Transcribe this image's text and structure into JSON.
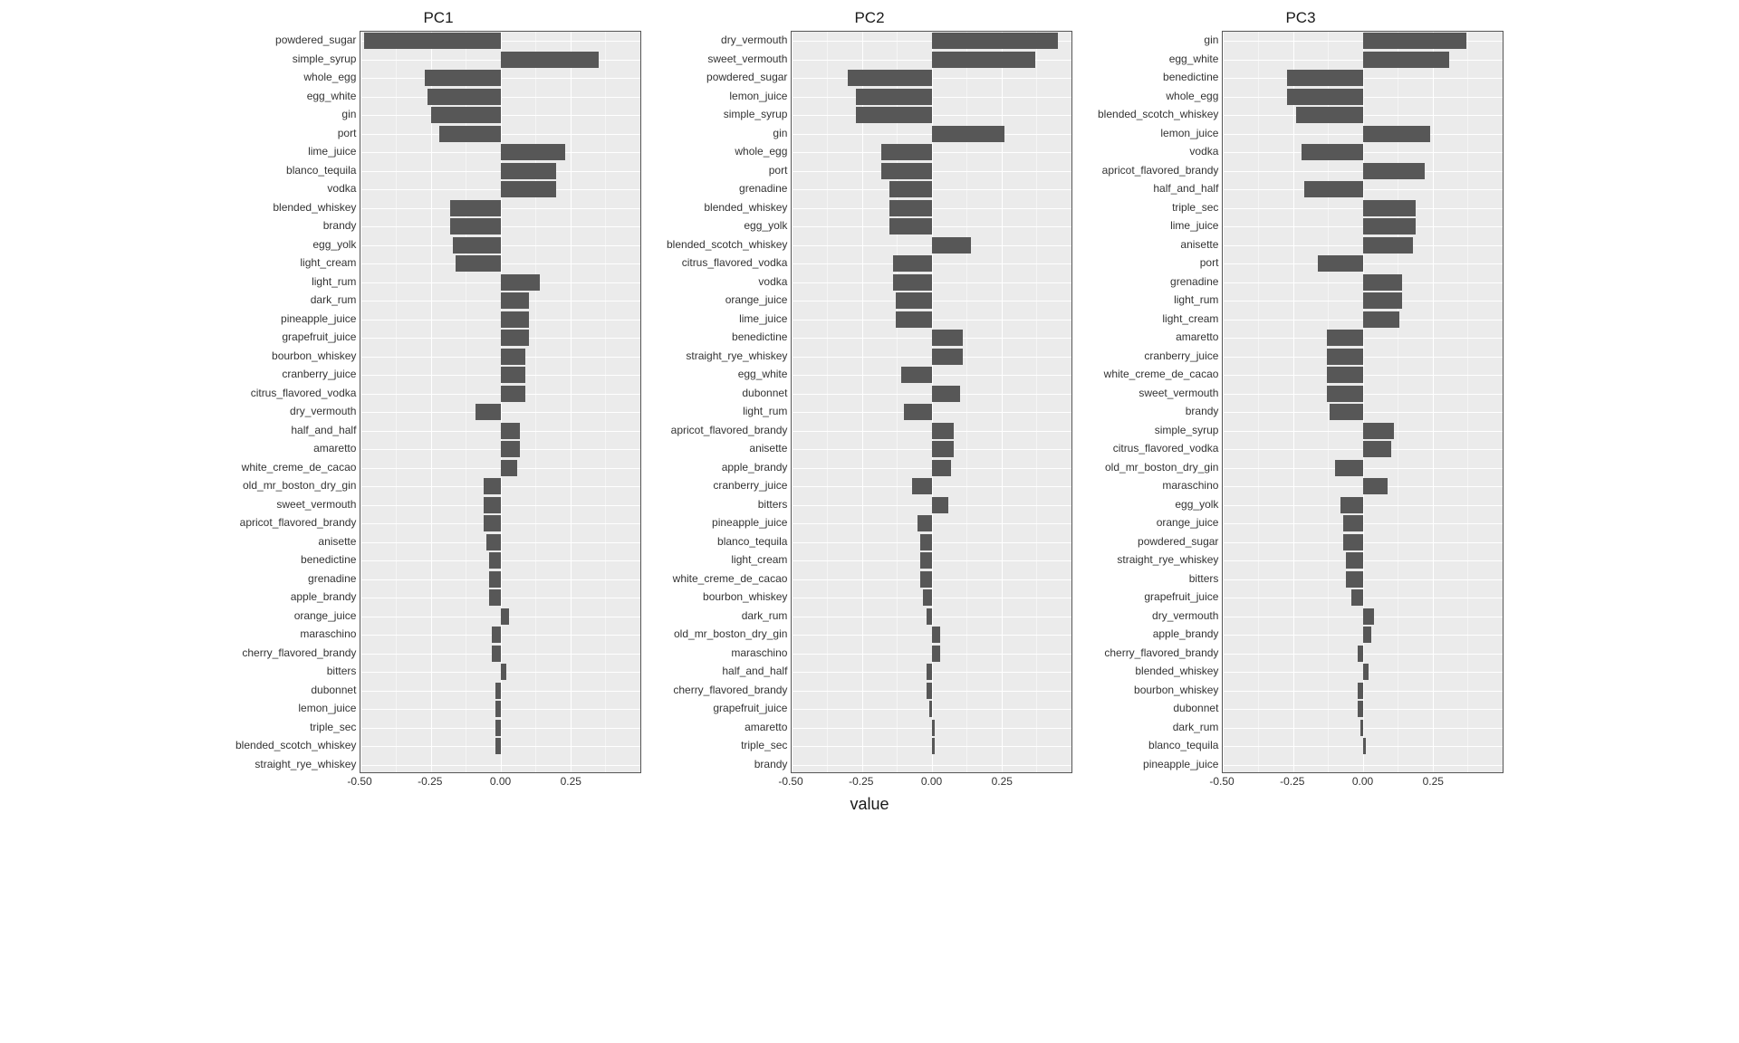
{
  "x_axis_title": "value",
  "x_domain": [
    -0.5,
    0.5
  ],
  "x_major_ticks": [
    -0.5,
    -0.25,
    0.0,
    0.25
  ],
  "x_minor_ticks": [
    -0.375,
    -0.125,
    0.125,
    0.375
  ],
  "x_tick_labels": [
    "-0.50",
    "-0.25",
    "0.00",
    "0.25"
  ],
  "panels": [
    {
      "title": "PC1",
      "rows": [
        {
          "label": "powdered_sugar",
          "value": -0.49
        },
        {
          "label": "simple_syrup",
          "value": 0.35
        },
        {
          "label": "whole_egg",
          "value": -0.27
        },
        {
          "label": "egg_white",
          "value": -0.26
        },
        {
          "label": "gin",
          "value": -0.25
        },
        {
          "label": "port",
          "value": -0.22
        },
        {
          "label": "lime_juice",
          "value": 0.23
        },
        {
          "label": "blanco_tequila",
          "value": 0.2
        },
        {
          "label": "vodka",
          "value": 0.2
        },
        {
          "label": "blended_whiskey",
          "value": -0.18
        },
        {
          "label": "brandy",
          "value": -0.18
        },
        {
          "label": "egg_yolk",
          "value": -0.17
        },
        {
          "label": "light_cream",
          "value": -0.16
        },
        {
          "label": "light_rum",
          "value": 0.14
        },
        {
          "label": "dark_rum",
          "value": 0.1
        },
        {
          "label": "pineapple_juice",
          "value": 0.1
        },
        {
          "label": "grapefruit_juice",
          "value": 0.1
        },
        {
          "label": "bourbon_whiskey",
          "value": 0.09
        },
        {
          "label": "cranberry_juice",
          "value": 0.09
        },
        {
          "label": "citrus_flavored_vodka",
          "value": 0.09
        },
        {
          "label": "dry_vermouth",
          "value": -0.09
        },
        {
          "label": "half_and_half",
          "value": 0.07
        },
        {
          "label": "amaretto",
          "value": 0.07
        },
        {
          "label": "white_creme_de_cacao",
          "value": 0.06
        },
        {
          "label": "old_mr_boston_dry_gin",
          "value": -0.06
        },
        {
          "label": "sweet_vermouth",
          "value": -0.06
        },
        {
          "label": "apricot_flavored_brandy",
          "value": -0.06
        },
        {
          "label": "anisette",
          "value": -0.05
        },
        {
          "label": "benedictine",
          "value": -0.04
        },
        {
          "label": "grenadine",
          "value": -0.04
        },
        {
          "label": "apple_brandy",
          "value": -0.04
        },
        {
          "label": "orange_juice",
          "value": 0.03
        },
        {
          "label": "maraschino",
          "value": -0.03
        },
        {
          "label": "cherry_flavored_brandy",
          "value": -0.03
        },
        {
          "label": "bitters",
          "value": 0.02
        },
        {
          "label": "dubonnet",
          "value": -0.02
        },
        {
          "label": "lemon_juice",
          "value": -0.02
        },
        {
          "label": "triple_sec",
          "value": -0.02
        },
        {
          "label": "blended_scotch_whiskey",
          "value": -0.02
        },
        {
          "label": "straight_rye_whiskey",
          "value": 0.0
        }
      ]
    },
    {
      "title": "PC2",
      "rows": [
        {
          "label": "dry_vermouth",
          "value": 0.45
        },
        {
          "label": "sweet_vermouth",
          "value": 0.37
        },
        {
          "label": "powdered_sugar",
          "value": -0.3
        },
        {
          "label": "lemon_juice",
          "value": -0.27
        },
        {
          "label": "simple_syrup",
          "value": -0.27
        },
        {
          "label": "gin",
          "value": 0.26
        },
        {
          "label": "whole_egg",
          "value": -0.18
        },
        {
          "label": "port",
          "value": -0.18
        },
        {
          "label": "grenadine",
          "value": -0.15
        },
        {
          "label": "blended_whiskey",
          "value": -0.15
        },
        {
          "label": "egg_yolk",
          "value": -0.15
        },
        {
          "label": "blended_scotch_whiskey",
          "value": 0.14
        },
        {
          "label": "citrus_flavored_vodka",
          "value": -0.14
        },
        {
          "label": "vodka",
          "value": -0.14
        },
        {
          "label": "orange_juice",
          "value": -0.13
        },
        {
          "label": "lime_juice",
          "value": -0.13
        },
        {
          "label": "benedictine",
          "value": 0.11
        },
        {
          "label": "straight_rye_whiskey",
          "value": 0.11
        },
        {
          "label": "egg_white",
          "value": -0.11
        },
        {
          "label": "dubonnet",
          "value": 0.1
        },
        {
          "label": "light_rum",
          "value": -0.1
        },
        {
          "label": "apricot_flavored_brandy",
          "value": 0.08
        },
        {
          "label": "anisette",
          "value": 0.08
        },
        {
          "label": "apple_brandy",
          "value": 0.07
        },
        {
          "label": "cranberry_juice",
          "value": -0.07
        },
        {
          "label": "bitters",
          "value": 0.06
        },
        {
          "label": "pineapple_juice",
          "value": -0.05
        },
        {
          "label": "blanco_tequila",
          "value": -0.04
        },
        {
          "label": "light_cream",
          "value": -0.04
        },
        {
          "label": "white_creme_de_cacao",
          "value": -0.04
        },
        {
          "label": "bourbon_whiskey",
          "value": -0.03
        },
        {
          "label": "dark_rum",
          "value": -0.02
        },
        {
          "label": "old_mr_boston_dry_gin",
          "value": 0.03
        },
        {
          "label": "maraschino",
          "value": 0.03
        },
        {
          "label": "half_and_half",
          "value": -0.02
        },
        {
          "label": "cherry_flavored_brandy",
          "value": -0.02
        },
        {
          "label": "grapefruit_juice",
          "value": -0.01
        },
        {
          "label": "amaretto",
          "value": 0.01
        },
        {
          "label": "triple_sec",
          "value": 0.01
        },
        {
          "label": "brandy",
          "value": 0.0
        }
      ]
    },
    {
      "title": "PC3",
      "rows": [
        {
          "label": "gin",
          "value": 0.37
        },
        {
          "label": "egg_white",
          "value": 0.31
        },
        {
          "label": "benedictine",
          "value": -0.27
        },
        {
          "label": "whole_egg",
          "value": -0.27
        },
        {
          "label": "blended_scotch_whiskey",
          "value": -0.24
        },
        {
          "label": "lemon_juice",
          "value": 0.24
        },
        {
          "label": "vodka",
          "value": -0.22
        },
        {
          "label": "apricot_flavored_brandy",
          "value": 0.22
        },
        {
          "label": "half_and_half",
          "value": -0.21
        },
        {
          "label": "triple_sec",
          "value": 0.19
        },
        {
          "label": "lime_juice",
          "value": 0.19
        },
        {
          "label": "anisette",
          "value": 0.18
        },
        {
          "label": "port",
          "value": -0.16
        },
        {
          "label": "grenadine",
          "value": 0.14
        },
        {
          "label": "light_rum",
          "value": 0.14
        },
        {
          "label": "light_cream",
          "value": 0.13
        },
        {
          "label": "amaretto",
          "value": -0.13
        },
        {
          "label": "cranberry_juice",
          "value": -0.13
        },
        {
          "label": "white_creme_de_cacao",
          "value": -0.13
        },
        {
          "label": "sweet_vermouth",
          "value": -0.13
        },
        {
          "label": "brandy",
          "value": -0.12
        },
        {
          "label": "simple_syrup",
          "value": 0.11
        },
        {
          "label": "citrus_flavored_vodka",
          "value": 0.1
        },
        {
          "label": "old_mr_boston_dry_gin",
          "value": -0.1
        },
        {
          "label": "maraschino",
          "value": 0.09
        },
        {
          "label": "egg_yolk",
          "value": -0.08
        },
        {
          "label": "orange_juice",
          "value": -0.07
        },
        {
          "label": "powdered_sugar",
          "value": -0.07
        },
        {
          "label": "straight_rye_whiskey",
          "value": -0.06
        },
        {
          "label": "bitters",
          "value": -0.06
        },
        {
          "label": "grapefruit_juice",
          "value": -0.04
        },
        {
          "label": "dry_vermouth",
          "value": 0.04
        },
        {
          "label": "apple_brandy",
          "value": 0.03
        },
        {
          "label": "cherry_flavored_brandy",
          "value": -0.02
        },
        {
          "label": "blended_whiskey",
          "value": 0.02
        },
        {
          "label": "bourbon_whiskey",
          "value": -0.02
        },
        {
          "label": "dubonnet",
          "value": -0.02
        },
        {
          "label": "dark_rum",
          "value": -0.01
        },
        {
          "label": "blanco_tequila",
          "value": 0.01
        },
        {
          "label": "pineapple_juice",
          "value": 0.0
        }
      ]
    }
  ],
  "chart_data": {
    "type": "bar",
    "title": "",
    "xlabel": "value",
    "ylabel": "",
    "xlim": [
      -0.5,
      0.5
    ],
    "facets": [
      "PC1",
      "PC2",
      "PC3"
    ],
    "series": [
      {
        "name": "PC1",
        "categories": [
          "powdered_sugar",
          "simple_syrup",
          "whole_egg",
          "egg_white",
          "gin",
          "port",
          "lime_juice",
          "blanco_tequila",
          "vodka",
          "blended_whiskey",
          "brandy",
          "egg_yolk",
          "light_cream",
          "light_rum",
          "dark_rum",
          "pineapple_juice",
          "grapefruit_juice",
          "bourbon_whiskey",
          "cranberry_juice",
          "citrus_flavored_vodka",
          "dry_vermouth",
          "half_and_half",
          "amaretto",
          "white_creme_de_cacao",
          "old_mr_boston_dry_gin",
          "sweet_vermouth",
          "apricot_flavored_brandy",
          "anisette",
          "benedictine",
          "grenadine",
          "apple_brandy",
          "orange_juice",
          "maraschino",
          "cherry_flavored_brandy",
          "bitters",
          "dubonnet",
          "lemon_juice",
          "triple_sec",
          "blended_scotch_whiskey",
          "straight_rye_whiskey"
        ],
        "values": [
          -0.49,
          0.35,
          -0.27,
          -0.26,
          -0.25,
          -0.22,
          0.23,
          0.2,
          0.2,
          -0.18,
          -0.18,
          -0.17,
          -0.16,
          0.14,
          0.1,
          0.1,
          0.1,
          0.09,
          0.09,
          0.09,
          -0.09,
          0.07,
          0.07,
          0.06,
          -0.06,
          -0.06,
          -0.06,
          -0.05,
          -0.04,
          -0.04,
          -0.04,
          0.03,
          -0.03,
          -0.03,
          0.02,
          -0.02,
          -0.02,
          -0.02,
          -0.02,
          0.0
        ]
      },
      {
        "name": "PC2",
        "categories": [
          "dry_vermouth",
          "sweet_vermouth",
          "powdered_sugar",
          "lemon_juice",
          "simple_syrup",
          "gin",
          "whole_egg",
          "port",
          "grenadine",
          "blended_whiskey",
          "egg_yolk",
          "blended_scotch_whiskey",
          "citrus_flavored_vodka",
          "vodka",
          "orange_juice",
          "lime_juice",
          "benedictine",
          "straight_rye_whiskey",
          "egg_white",
          "dubonnet",
          "light_rum",
          "apricot_flavored_brandy",
          "anisette",
          "apple_brandy",
          "cranberry_juice",
          "bitters",
          "pineapple_juice",
          "blanco_tequila",
          "light_cream",
          "white_creme_de_cacao",
          "bourbon_whiskey",
          "dark_rum",
          "old_mr_boston_dry_gin",
          "maraschino",
          "half_and_half",
          "cherry_flavored_brandy",
          "grapefruit_juice",
          "amaretto",
          "triple_sec",
          "brandy"
        ],
        "values": [
          0.45,
          0.37,
          -0.3,
          -0.27,
          -0.27,
          0.26,
          -0.18,
          -0.18,
          -0.15,
          -0.15,
          -0.15,
          0.14,
          -0.14,
          -0.14,
          -0.13,
          -0.13,
          0.11,
          0.11,
          -0.11,
          0.1,
          -0.1,
          0.08,
          0.08,
          0.07,
          -0.07,
          0.06,
          -0.05,
          -0.04,
          -0.04,
          -0.04,
          -0.03,
          -0.02,
          0.03,
          0.03,
          -0.02,
          -0.02,
          -0.01,
          0.01,
          0.01,
          0.0
        ]
      },
      {
        "name": "PC3",
        "categories": [
          "gin",
          "egg_white",
          "benedictine",
          "whole_egg",
          "blended_scotch_whiskey",
          "lemon_juice",
          "vodka",
          "apricot_flavored_brandy",
          "half_and_half",
          "triple_sec",
          "lime_juice",
          "anisette",
          "port",
          "grenadine",
          "light_rum",
          "light_cream",
          "amaretto",
          "cranberry_juice",
          "white_creme_de_cacao",
          "sweet_vermouth",
          "brandy",
          "simple_syrup",
          "citrus_flavored_vodka",
          "old_mr_boston_dry_gin",
          "maraschino",
          "egg_yolk",
          "orange_juice",
          "powdered_sugar",
          "straight_rye_whiskey",
          "bitters",
          "grapefruit_juice",
          "dry_vermouth",
          "apple_brandy",
          "cherry_flavored_brandy",
          "blended_whiskey",
          "bourbon_whiskey",
          "dubonnet",
          "dark_rum",
          "blanco_tequila",
          "pineapple_juice"
        ],
        "values": [
          0.37,
          0.31,
          -0.27,
          -0.27,
          -0.24,
          0.24,
          -0.22,
          0.22,
          -0.21,
          0.19,
          0.19,
          0.18,
          -0.16,
          0.14,
          0.14,
          0.13,
          -0.13,
          -0.13,
          -0.13,
          -0.13,
          -0.12,
          0.11,
          0.1,
          -0.1,
          0.09,
          -0.08,
          -0.07,
          -0.07,
          -0.06,
          -0.06,
          -0.04,
          0.04,
          0.03,
          -0.02,
          0.02,
          -0.02,
          -0.02,
          -0.01,
          0.01,
          0.0
        ]
      }
    ]
  }
}
